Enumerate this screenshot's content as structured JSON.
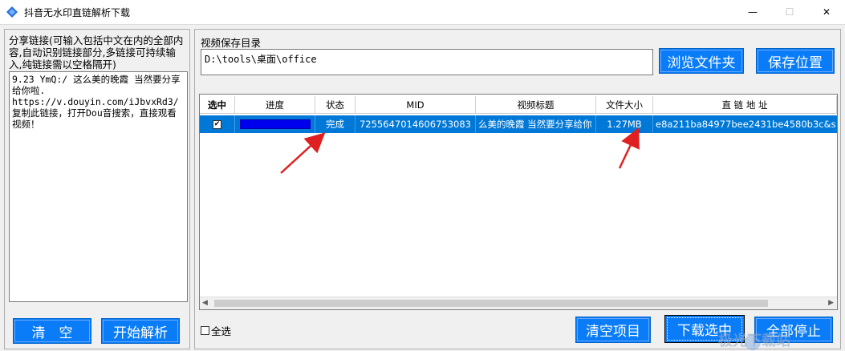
{
  "window": {
    "title": "抖音无水印直链解析下载",
    "minimize_glyph": "—",
    "maximize_glyph": "☐",
    "close_glyph": "✕"
  },
  "left": {
    "share_label": "分享链接(可输入包括中文在内的全部内容,自动识别链接部分,多链接可持续输入,纯链接需以空格隔开)",
    "share_text": "9.23 YmQ:/ 这么美的晚霞 当然要分享给你啦.\nhttps://v.douyin.com/iJbvxRd3/ 复制此链接，打开Dou音搜索，直接观看视频！",
    "clear_button": "清　空",
    "parse_button": "开始解析"
  },
  "right": {
    "dir_label": "视频保存目录",
    "dir_value": "D:\\tools\\桌面\\office",
    "browse_button": "浏览文件夹",
    "save_button": "保存位置",
    "table": {
      "headers": [
        "选中",
        "进度",
        "状态",
        "MID",
        "视频标题",
        "文件大小",
        "直 链 地 址"
      ],
      "rows": [
        {
          "checked_glyph": "✔",
          "progress": 1.0,
          "status": "完成",
          "mid": "7255647014606753083",
          "title": "么美的晚霞 当然要分享给你",
          "size": "1.27MB",
          "url": "e8a211ba84977bee2431be4580b3c&s"
        }
      ]
    },
    "select_all_label": "全选",
    "clear_items_button": "清空项目",
    "download_button": "下载选中",
    "stop_all_button": "全部停止",
    "scroll_left_glyph": "◀",
    "scroll_right_glyph": "▶"
  },
  "watermark": "极光下载站",
  "colors": {
    "button_blue": "#0a7cf7",
    "row_selected": "#0078d7",
    "progress_fill": "#0000ee",
    "arrow_red": "#e02020"
  }
}
